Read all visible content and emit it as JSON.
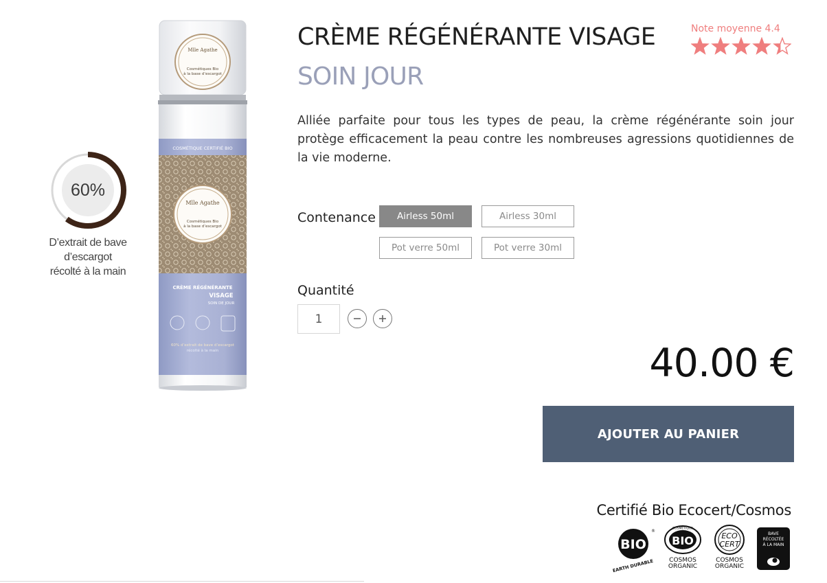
{
  "badge": {
    "percent": "60%",
    "percent_value": 0.6,
    "caption_lines": [
      "D’extrait de bave",
      "d’escargot",
      "récolté à la main"
    ]
  },
  "bottle": {
    "brand": "Mlle Agathe",
    "brand_line1": "Cosmétiques Bio",
    "brand_line2": "à la base d’escargot",
    "band_text": "COSMÉTIQUE CERTIFIÉ BIO",
    "label_line1": "CRÈME RÉGÉNÉRANTE",
    "label_line2": "VISAGE",
    "label_line3": "SOIN DE JOUR",
    "extract_line1": "60% d’extrait de bave d’escargot",
    "extract_line2": "récolté à la main"
  },
  "product": {
    "title": "CRÈME RÉGÉNÉRANTE VISAGE",
    "subtitle": "SOIN JOUR",
    "description": "Alliée parfaite pour tous les types de peau, la crème régénérante soin jour protège efficacement la peau contre les nombreuses agressions quotidiennes de la vie moderne.",
    "rating_label": "Note moyenne 4.4",
    "rating_value": 4.4,
    "rating_max": 5
  },
  "options": {
    "label": "Contenance",
    "items": [
      "Airless 50ml",
      "Airless 30ml",
      "Pot verre 50ml",
      "Pot verre 30ml"
    ],
    "selected": "Airless 50ml"
  },
  "quantity": {
    "label": "Quantité",
    "value": "1"
  },
  "price": "40.00 €",
  "cart_button": "AJOUTER AU PANIER",
  "certifications": {
    "title": "Certifié Bio Ecocert/Cosmos",
    "logos": [
      {
        "name": "bio-earth-durable-icon",
        "text": "BIO",
        "caption": "EARTH DURABLE"
      },
      {
        "name": "cosmos-bio-icon",
        "text": "BIO",
        "ring": "COSMÉTIQUE",
        "caption1": "COSMOS",
        "caption2": "ORGANIC"
      },
      {
        "name": "ecocert-icon",
        "text1": "ECO",
        "text2": "CERT",
        "caption1": "COSMOS",
        "caption2": "ORGANIC"
      },
      {
        "name": "bave-recoltee-icon",
        "line1": "BAVE",
        "line2": "RÉCOLTÉE",
        "line3": "À LA MAIN"
      }
    ]
  },
  "colors": {
    "accent_button": "#4f5f75",
    "rating": "#ef7e7e",
    "subtitle": "#9aa0b8",
    "selected_option": "#888888",
    "badge_ring": "#3d2417"
  }
}
